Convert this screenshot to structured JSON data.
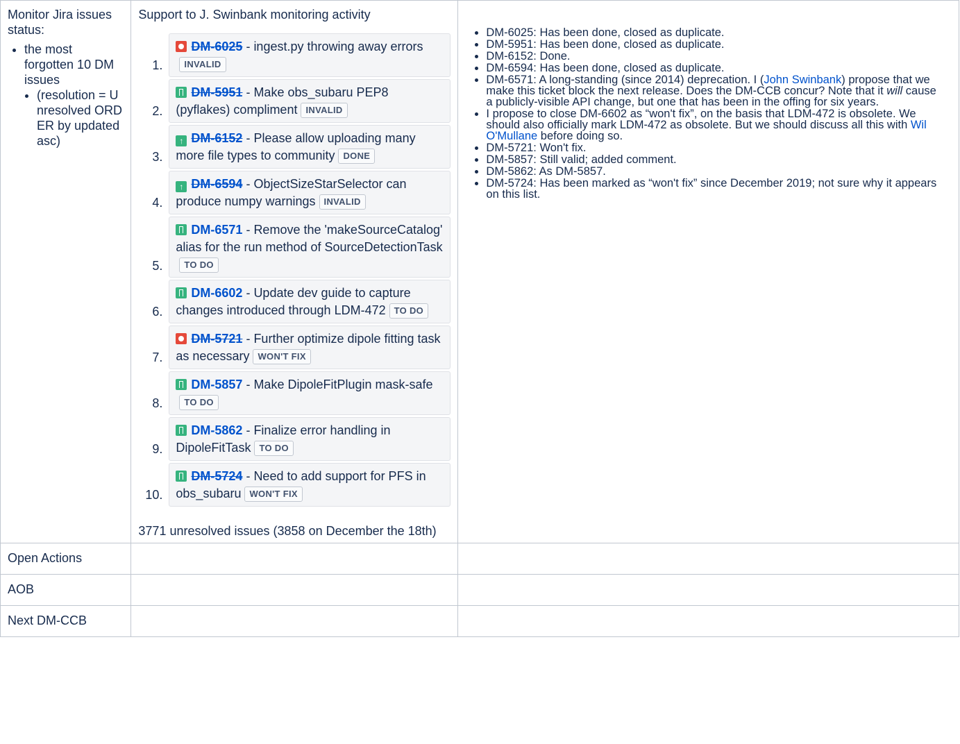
{
  "row1": {
    "col1": {
      "title": "Monitor Jira issues status:",
      "bullet": "the most forgotten 10 DM issues",
      "sub_bullet": "(resolution = Unresolved ORDER by updated asc)"
    },
    "col2": {
      "heading": "Support to J. Swinbank monitoring activity",
      "issues": [
        {
          "num": "1.",
          "type_icon": "bug-icon",
          "key": "DM-6025",
          "summary": "ingest.py throwing away errors",
          "status": "INVALID"
        },
        {
          "num": "2.",
          "type_icon": "story-icon",
          "key": "DM-5951",
          "summary": "Make obs_subaru PEP8 (pyflakes) compliment",
          "status": "INVALID"
        },
        {
          "num": "3.",
          "type_icon": "improvement-icon",
          "key": "DM-6152",
          "summary": "Please allow uploading many more file types to community",
          "status": "DONE"
        },
        {
          "num": "4.",
          "type_icon": "improvement-icon",
          "key": "DM-6594",
          "summary": "ObjectSizeStarSelector can produce numpy warnings",
          "status": "INVALID"
        },
        {
          "num": "5.",
          "type_icon": "story-icon",
          "key": "DM-6571",
          "summary": "Remove the 'makeSourceCatalog' alias for the run method of SourceDetectionTask",
          "status": "TO DO"
        },
        {
          "num": "6.",
          "type_icon": "story-icon",
          "key": "DM-6602",
          "summary": "Update dev guide to capture changes introduced through LDM-472",
          "status": "TO DO"
        },
        {
          "num": "7.",
          "type_icon": "bug-icon",
          "key": "DM-5721",
          "summary": "Further optimize dipole fitting task as necessary",
          "status": "WON'T FIX"
        },
        {
          "num": "8.",
          "type_icon": "story-icon",
          "key": "DM-5857",
          "summary": "Make DipoleFitPlugin mask-safe",
          "status": "TO DO"
        },
        {
          "num": "9.",
          "type_icon": "story-icon",
          "key": "DM-5862",
          "summary": "Finalize error handling in DipoleFitTask",
          "status": "TO DO"
        },
        {
          "num": "10.",
          "type_icon": "story-icon",
          "key": "DM-5724",
          "summary": "Need to add support for PFS in obs_subaru",
          "status": "WON'T FIX"
        }
      ],
      "footer": "3771 unresolved issues (3858 on December the 18th)"
    },
    "col3": {
      "notes": {
        "n1": "DM-6025: Has been done, closed as duplicate.",
        "n2": "DM-5951: Has been done, closed as duplicate.",
        "n3": "DM-6152: Done.",
        "n4": "DM-6594: Has been done, closed as duplicate.",
        "n5_a": "DM-6571: A long-standing (since 2014) deprecation. I (",
        "n5_link": "John Swinbank",
        "n5_b": ") propose that we make this ticket block the next release. Does the DM-CCB concur? Note that it ",
        "n5_em": "will",
        "n5_c": " cause a publicly-visible API change, but one that has been in the offing for six years.",
        "n6_a": "I propose to close DM-6602 as “won't fix”, on the basis that LDM-472 is obsolete. We should also officially mark LDM-472 as obsolete. But we should discuss all this with ",
        "n6_link": "Wil O'Mullane",
        "n6_b": " before doing so.",
        "n7": "DM-5721: Won't fix.",
        "n8": "DM-5857: Still valid; added comment.",
        "n9": "DM-5862: As DM-5857.",
        "n10": "DM-5724: Has been marked as “won't fix” since December 2019; not sure why it appears on this list."
      }
    }
  },
  "rows": [
    {
      "label": "Open Actions"
    },
    {
      "label": "AOB"
    },
    {
      "label": "Next DM-CCB"
    }
  ],
  "colors": {
    "link": "#0052cc",
    "border": "#c1c7d0",
    "card_bg": "#f4f5f7",
    "bug": "#e5493a",
    "story": "#36b37e"
  }
}
